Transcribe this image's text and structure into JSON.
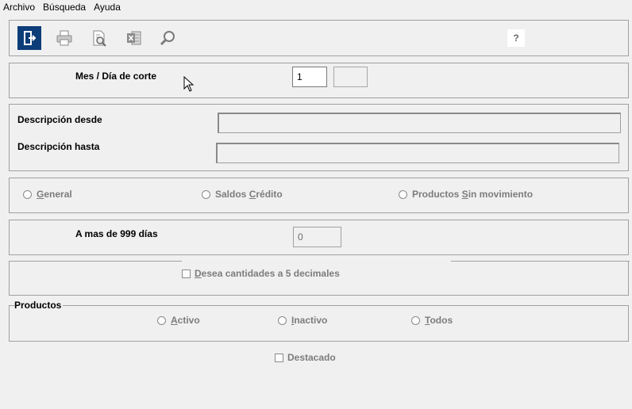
{
  "menu": [
    "Archivo",
    "Búsqueda",
    "Ayuda"
  ],
  "toolbar": {
    "icons": [
      "exit-icon",
      "print-icon",
      "print-preview-icon",
      "excel-icon",
      "search-icon",
      "help-icon"
    ],
    "help_label": "?",
    "accent_color": "#0d3d78"
  },
  "corte": {
    "label": "Mes / Día  de corte",
    "mes_value": "1",
    "dia_value": ""
  },
  "descripcion": {
    "desde_label": "Descripción desde",
    "desde_value": "",
    "hasta_label": "Descripción hasta",
    "hasta_value": ""
  },
  "report_type": {
    "options": [
      {
        "pre": "",
        "key": "G",
        "post": "eneral"
      },
      {
        "pre": "Saldos ",
        "key": "C",
        "post": "rédito"
      },
      {
        "pre": "Productos ",
        "key": "S",
        "post": "in movimiento"
      }
    ]
  },
  "dias": {
    "label": "A mas de 999 días",
    "value": "0"
  },
  "decimales": {
    "key": "D",
    "rest": "esea cantidades a 5 decimales"
  },
  "productos": {
    "title": "Productos",
    "options": [
      {
        "key": "A",
        "rest": "ctivo"
      },
      {
        "key": "I",
        "rest": "nactivo"
      },
      {
        "key": "T",
        "rest": "odos"
      }
    ]
  },
  "destacado": {
    "label": "Destacado"
  }
}
